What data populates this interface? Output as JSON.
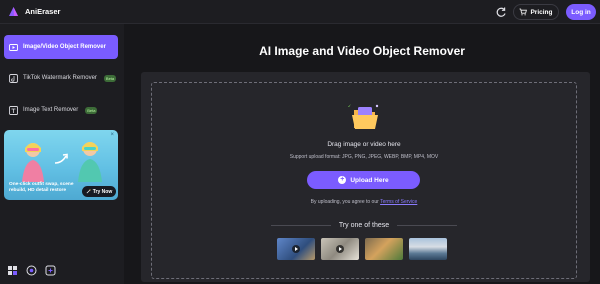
{
  "header": {
    "app_name": "AniEraser",
    "pricing_label": "Pricing",
    "login_label": "Log in"
  },
  "sidebar": {
    "items": [
      {
        "label": "Image/Video Object Remover",
        "icon": "image-video-icon",
        "active": true,
        "badge": ""
      },
      {
        "label": "TikTok Watermark Remover",
        "icon": "tiktok-icon",
        "active": false,
        "badge": "Beta"
      },
      {
        "label": "Image Text Remover",
        "icon": "image-text-icon",
        "active": false,
        "badge": "Beta"
      }
    ],
    "promo": {
      "caption": "One-click outfit swap, scene rebuild, HD detail restore",
      "button_label": "Try Now",
      "close_glyph": "×"
    }
  },
  "main": {
    "title": "AI Image and Video Object Remover",
    "drag_text": "Drag image or video here",
    "formats_text": "Support upload format: JPG, PNG, JPEG, WEBP, BMP, MP4, MOV",
    "upload_label": "Upload Here",
    "agree_prefix": "By uploading, you agree to our",
    "terms_label": "Terms of Service",
    "try_label": "Try one of these"
  },
  "colors": {
    "accent": "#7b5cff",
    "background": "#17171a",
    "panel": "#26262b",
    "sidebar": "#1d1d21"
  }
}
